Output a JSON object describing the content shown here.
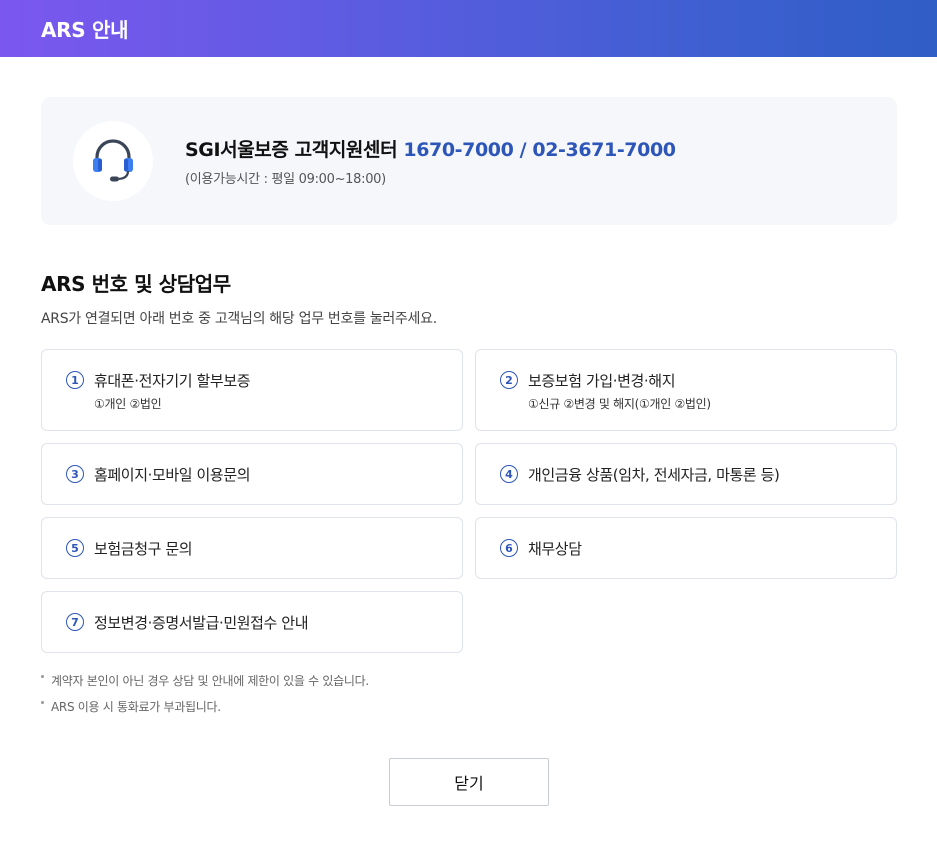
{
  "header": {
    "title": "ARS 안내"
  },
  "contact": {
    "center_name": "SGI서울보증 고객지원센터 ",
    "phones": "1670-7000 / 02-3671-7000",
    "hours": "(이용가능시간 : 평일 09:00~18:00)",
    "icon": "headset-icon"
  },
  "section": {
    "title": "ARS 번호 및 상담업무",
    "description": "ARS가 연결되면 아래 번호 중 고객님의 해당 업무 번호를 눌러주세요."
  },
  "services": [
    {
      "number": "1",
      "label": "휴대폰·전자기기 할부보증",
      "sub": "①개인  ②법인"
    },
    {
      "number": "2",
      "label": "보증보험 가입·변경·해지",
      "sub": "①신규  ②변경 및 해지(①개인 ②법인)"
    },
    {
      "number": "3",
      "label": "홈페이지·모바일 이용문의"
    },
    {
      "number": "4",
      "label": "개인금융 상품(임차, 전세자금, 마통론 등)"
    },
    {
      "number": "5",
      "label": "보험금청구 문의"
    },
    {
      "number": "6",
      "label": "채무상담"
    },
    {
      "number": "7",
      "label": "정보변경·증명서발급·민원접수 안내"
    }
  ],
  "notes": [
    "계약자 본인이 아닌 경우 상담 및 안내에 제한이 있을 수 있습니다.",
    "ARS 이용 시 통화료가 부과됩니다."
  ],
  "footer": {
    "close_label": "닫기"
  },
  "colors": {
    "accent": "#2d56b8",
    "header_start": "#7b57ef",
    "header_end": "#2f5ec6"
  }
}
